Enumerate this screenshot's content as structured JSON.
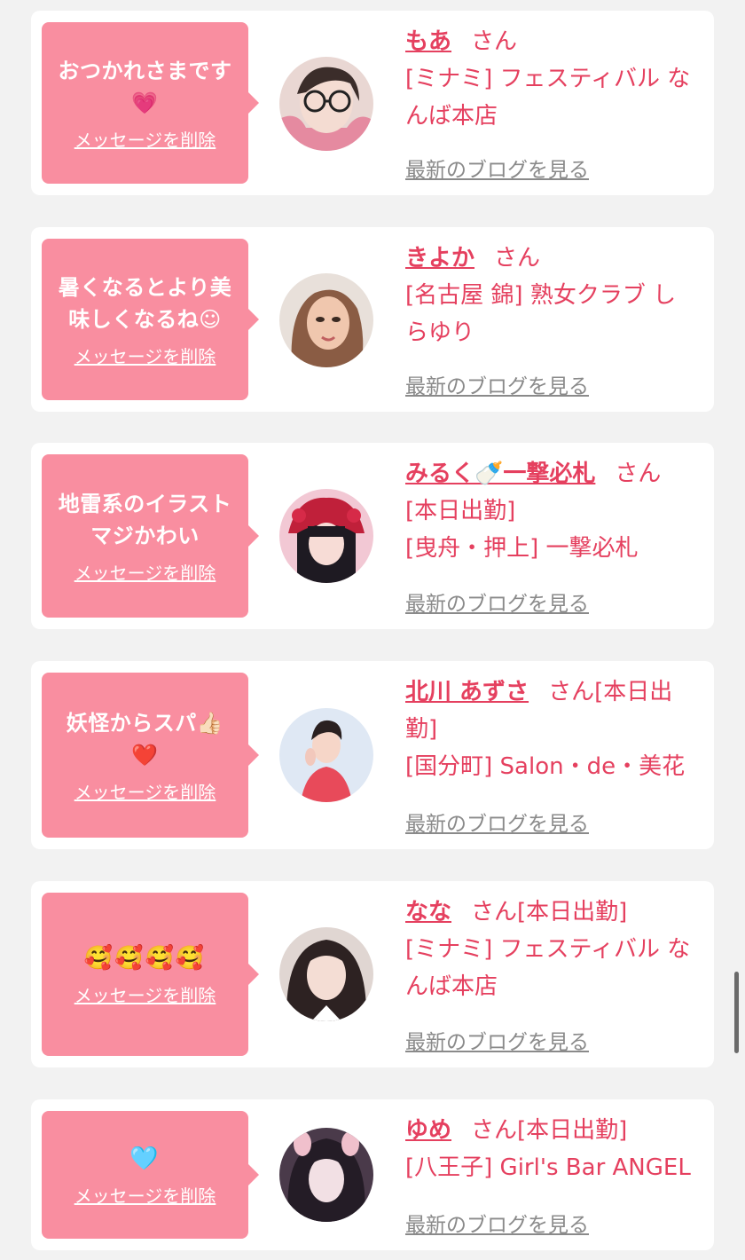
{
  "messages": [
    {
      "text": "おつかれさまです\n💗",
      "delete_label": "メッセージを削除",
      "name": "もあ",
      "san": "さん",
      "shop": "[ミナミ] フェスティバル なんば本店",
      "blog": "最新のブログを見る"
    },
    {
      "text": "暑くなるとより美味しくなるね☺",
      "delete_label": "メッセージを削除",
      "name": "きよか",
      "san": "さん",
      "shop": "[名古屋 錦] 熟女クラブ しらゆり",
      "blog": "最新のブログを見る"
    },
    {
      "text": "地雷系のイラスト\nマジかわい",
      "delete_label": "メッセージを削除",
      "name": "みるく🍼一撃必札",
      "san": "さん",
      "shop_line1": "[本日出勤]",
      "shop": "[曳舟・押上] 一撃必札",
      "blog": "最新のブログを見る"
    },
    {
      "text": "妖怪からスパ👍🏻\n❤️",
      "delete_label": "メッセージを削除",
      "name": "北川 あずさ",
      "san": "さん[本日出勤]",
      "shop": "[国分町] Salon・de・美花",
      "blog": "最新のブログを見る"
    },
    {
      "text": "🥰🥰🥰🥰",
      "delete_label": "メッセージを削除",
      "name": "なな",
      "san": "さん[本日出勤]",
      "shop": "[ミナミ] フェスティバル なんば本店",
      "blog": "最新のブログを見る"
    },
    {
      "text": "🩵",
      "delete_label": "メッセージを削除",
      "name": "ゆめ",
      "san": "さん[本日出勤]",
      "shop": "[八王子] Girl's Bar ANGEL",
      "blog": "最新のブログを見る"
    }
  ],
  "colors": {
    "bubble": "#f98ea0",
    "name": "#e5405f",
    "blog_link": "#8a8a8a",
    "card": "#ffffff",
    "background": "#f2f2f2"
  }
}
